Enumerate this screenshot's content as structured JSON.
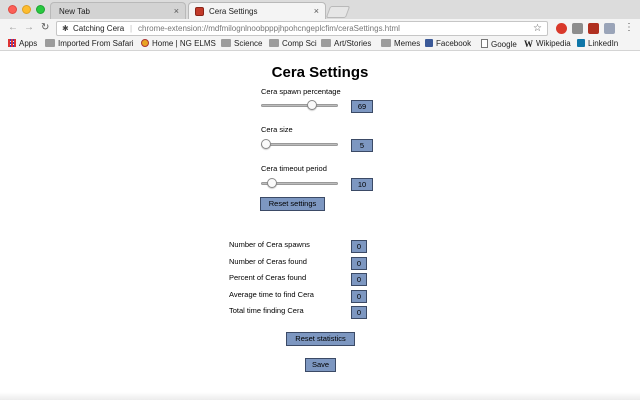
{
  "browser": {
    "tabs": [
      {
        "label": "New Tab"
      },
      {
        "label": "Cera Settings"
      }
    ],
    "tab_close_icon": "×",
    "address": {
      "site_label": "Catching Cera",
      "url": "chrome-extension://mdfmilognlnoobpppjhpohcngeplcfim/ceraSettings.html"
    },
    "bookmarks": [
      "Apps",
      "Imported From Safari",
      "Home | NG ELMS",
      "Science",
      "Comp Sci",
      "Art/Stories",
      "Memes",
      "Facebook",
      "Google",
      "Wikipedia",
      "LinkedIn"
    ]
  },
  "page": {
    "title": "Cera Settings",
    "settings": [
      {
        "label": "Cera spawn percentage",
        "value": "69",
        "fraction": 0.69
      },
      {
        "label": "Cera size",
        "value": "5",
        "fraction": 0.0
      },
      {
        "label": "Cera timeout period",
        "value": "10",
        "fraction": 0.09
      }
    ],
    "reset_settings_label": "Reset settings",
    "stats": [
      {
        "label": "Number of Cera spawns",
        "value": "0"
      },
      {
        "label": "Number of Ceras found",
        "value": "0"
      },
      {
        "label": "Percent of Ceras found",
        "value": "0"
      },
      {
        "label": "Average time to find Cera",
        "value": "0"
      },
      {
        "label": "Total time finding Cera",
        "value": "0"
      }
    ],
    "reset_statistics_label": "Reset statistics",
    "save_label": "Save"
  },
  "colors": {
    "button_fill": "#7d97c1",
    "button_border": "#3b4a66"
  }
}
